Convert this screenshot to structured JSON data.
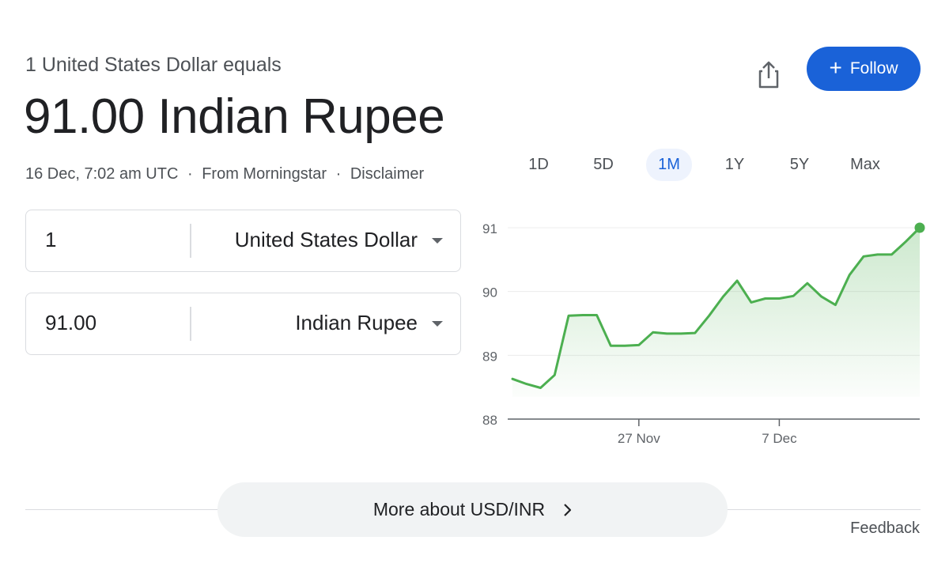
{
  "header": {
    "subtitle": "1 United States Dollar equals",
    "value": "91.00 Indian Rupee",
    "timestamp": "16 Dec, 7:02 am UTC",
    "source": "From Morningstar",
    "disclaimer": "Disclaimer",
    "separator": "·"
  },
  "actions": {
    "share_icon": "share-icon",
    "follow_label": "Follow",
    "follow_icon": "+"
  },
  "converter": {
    "from": {
      "amount": "1",
      "currency": "United States Dollar"
    },
    "to": {
      "amount": "91.00",
      "currency": "Indian Rupee"
    }
  },
  "ranges": {
    "tabs": [
      "1D",
      "5D",
      "1M",
      "1Y",
      "5Y",
      "Max"
    ],
    "active": "1M"
  },
  "chart_data": {
    "type": "area",
    "title": "",
    "xlabel": "",
    "ylabel": "",
    "ylim": [
      88,
      91
    ],
    "yticks": [
      88,
      89,
      90,
      91
    ],
    "xtick_labels": [
      {
        "label": "27 Nov",
        "index": 9
      },
      {
        "label": "7 Dec",
        "index": 19
      }
    ],
    "values": [
      88.63,
      88.55,
      88.49,
      88.69,
      89.62,
      89.63,
      89.63,
      89.15,
      89.15,
      89.16,
      89.36,
      89.34,
      89.34,
      89.35,
      89.62,
      89.92,
      90.17,
      89.83,
      89.89,
      89.89,
      89.93,
      90.13,
      89.92,
      89.79,
      90.26,
      90.55,
      90.58,
      90.58,
      90.78,
      91.0
    ],
    "grid": true,
    "colors": {
      "line": "#4caf50",
      "fill": "#4caf50",
      "grid": "#ececec",
      "axis": "#5f6368"
    }
  },
  "footer": {
    "more_label": "More about USD/INR",
    "feedback_label": "Feedback"
  }
}
